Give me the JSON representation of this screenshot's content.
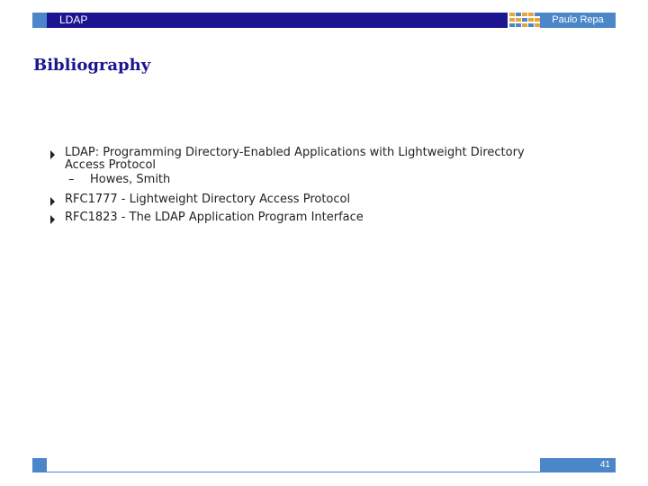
{
  "header": {
    "section": "LDAP",
    "author": "Paulo Repa",
    "colors": {
      "bar": "#1c1490",
      "accent": "#4a86c8",
      "grid_orange": "#e8a33a",
      "grid_blue": "#4a86c8"
    }
  },
  "slide": {
    "title": "Bibliography",
    "bullets": [
      {
        "line1": "LDAP: Programming Directory-Enabled Applications with Lightweight Directory",
        "line2": "Access Protocol",
        "sub_dash": "–",
        "sub_text": "Howes, Smith"
      },
      {
        "text": "RFC1777 - Lightweight Directory Access Protocol"
      },
      {
        "text": "RFC1823 - The LDAP Application Program Interface"
      }
    ]
  },
  "footer": {
    "page_number": "41"
  }
}
